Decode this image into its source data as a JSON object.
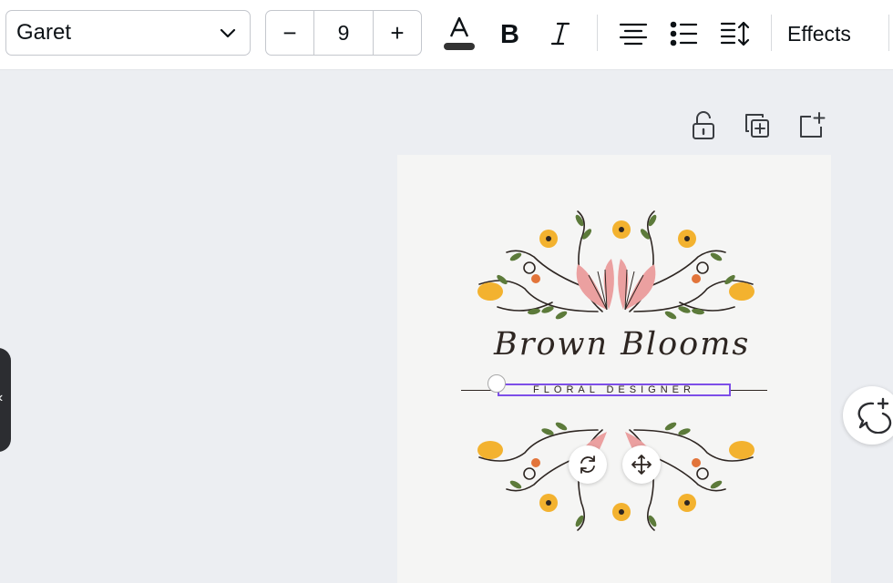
{
  "toolbar": {
    "font_family": "Garet",
    "font_size": "9",
    "decrease_label": "−",
    "increase_label": "+",
    "effects_label": "Effects",
    "icons": [
      "text-color-icon",
      "bold-icon",
      "italic-icon",
      "align-center-icon",
      "bulleted-list-icon",
      "line-spacing-icon"
    ],
    "text_color": "#333333"
  },
  "page_actions": {
    "icons": [
      "lock-icon",
      "duplicate-page-icon",
      "add-page-icon"
    ]
  },
  "design": {
    "brand_name": "Brown Blooms",
    "subtitle": "FLORAL DESIGNER",
    "selection_color": "#7d4ee8",
    "flower_colors": {
      "yellow": "#f3b22f",
      "pink": "#eba0a0",
      "leaf": "#5c7a3a",
      "orange": "#e2743a"
    }
  },
  "canvas_controls": {
    "icons": [
      "rotate-icon",
      "move-icon"
    ]
  },
  "side": {
    "collapse_glyph": "‹",
    "comment_icon": "add-comment-icon"
  }
}
